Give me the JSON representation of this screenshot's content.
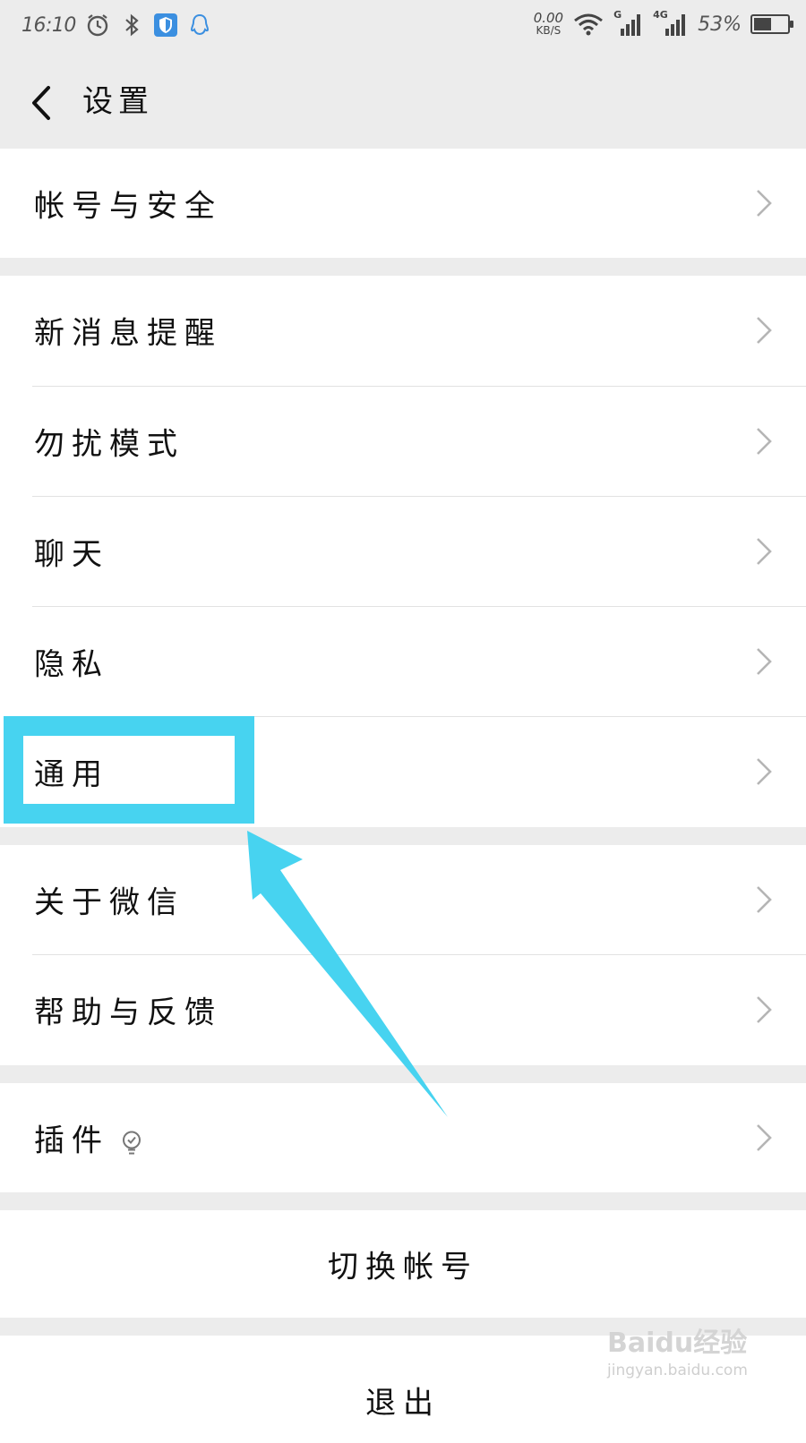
{
  "status_bar": {
    "time": "16:10",
    "net_speed_value": "0.00",
    "net_speed_unit": "KB/S",
    "network_g": "G",
    "network_4g": "4G",
    "battery_percent": "53%",
    "battery_level": 0.53,
    "icons": [
      "alarm-icon",
      "bluetooth-icon",
      "shield-icon",
      "qq-icon",
      "wifi-icon",
      "signal-icon",
      "battery-icon"
    ]
  },
  "header": {
    "title": "设置",
    "back_icon": "chevron-left-icon"
  },
  "menu": {
    "account_security": "帐号与安全",
    "new_message_alerts": "新消息提醒",
    "do_not_disturb": "勿扰模式",
    "chat": "聊天",
    "privacy": "隐私",
    "general": "通用",
    "about_wechat": "关于微信",
    "help_feedback": "帮助与反馈",
    "plugins": "插件",
    "switch_account": "切换帐号",
    "logout": "退出"
  },
  "annotation": {
    "highlight_color": "#47d3f0",
    "highlighted_item": "通用"
  },
  "watermark": {
    "brand": "Baidu经验",
    "url": "jingyan.baidu.com"
  },
  "colors": {
    "background": "#ececec",
    "row": "#ffffff",
    "text": "#111111",
    "chevron": "#b5b5b5"
  }
}
